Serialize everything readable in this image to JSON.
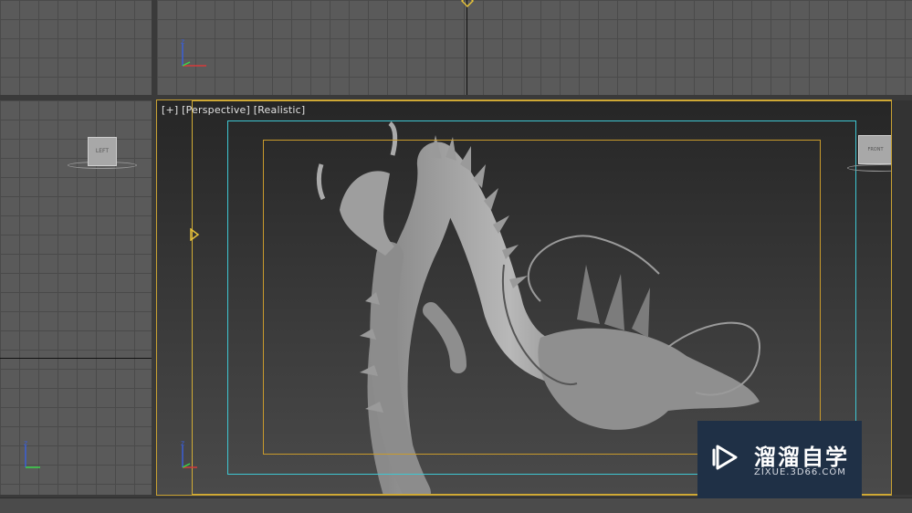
{
  "viewports": {
    "perspective": {
      "label_plus": "[+]",
      "label_view": "[Perspective]",
      "label_shading": "[Realistic]"
    },
    "left": {
      "viewcube_label": "LEFT"
    },
    "front": {
      "viewcube_label": "FRONT"
    }
  },
  "watermark": {
    "brand": "溜溜自学",
    "url": "ZIXUE.3D66.COM"
  },
  "colors": {
    "safe_frame_outer": "#d1ac36",
    "safe_frame_action": "#3ec6d2",
    "safe_frame_title": "#c99a2c",
    "watermark_bg": "#1f3046"
  }
}
